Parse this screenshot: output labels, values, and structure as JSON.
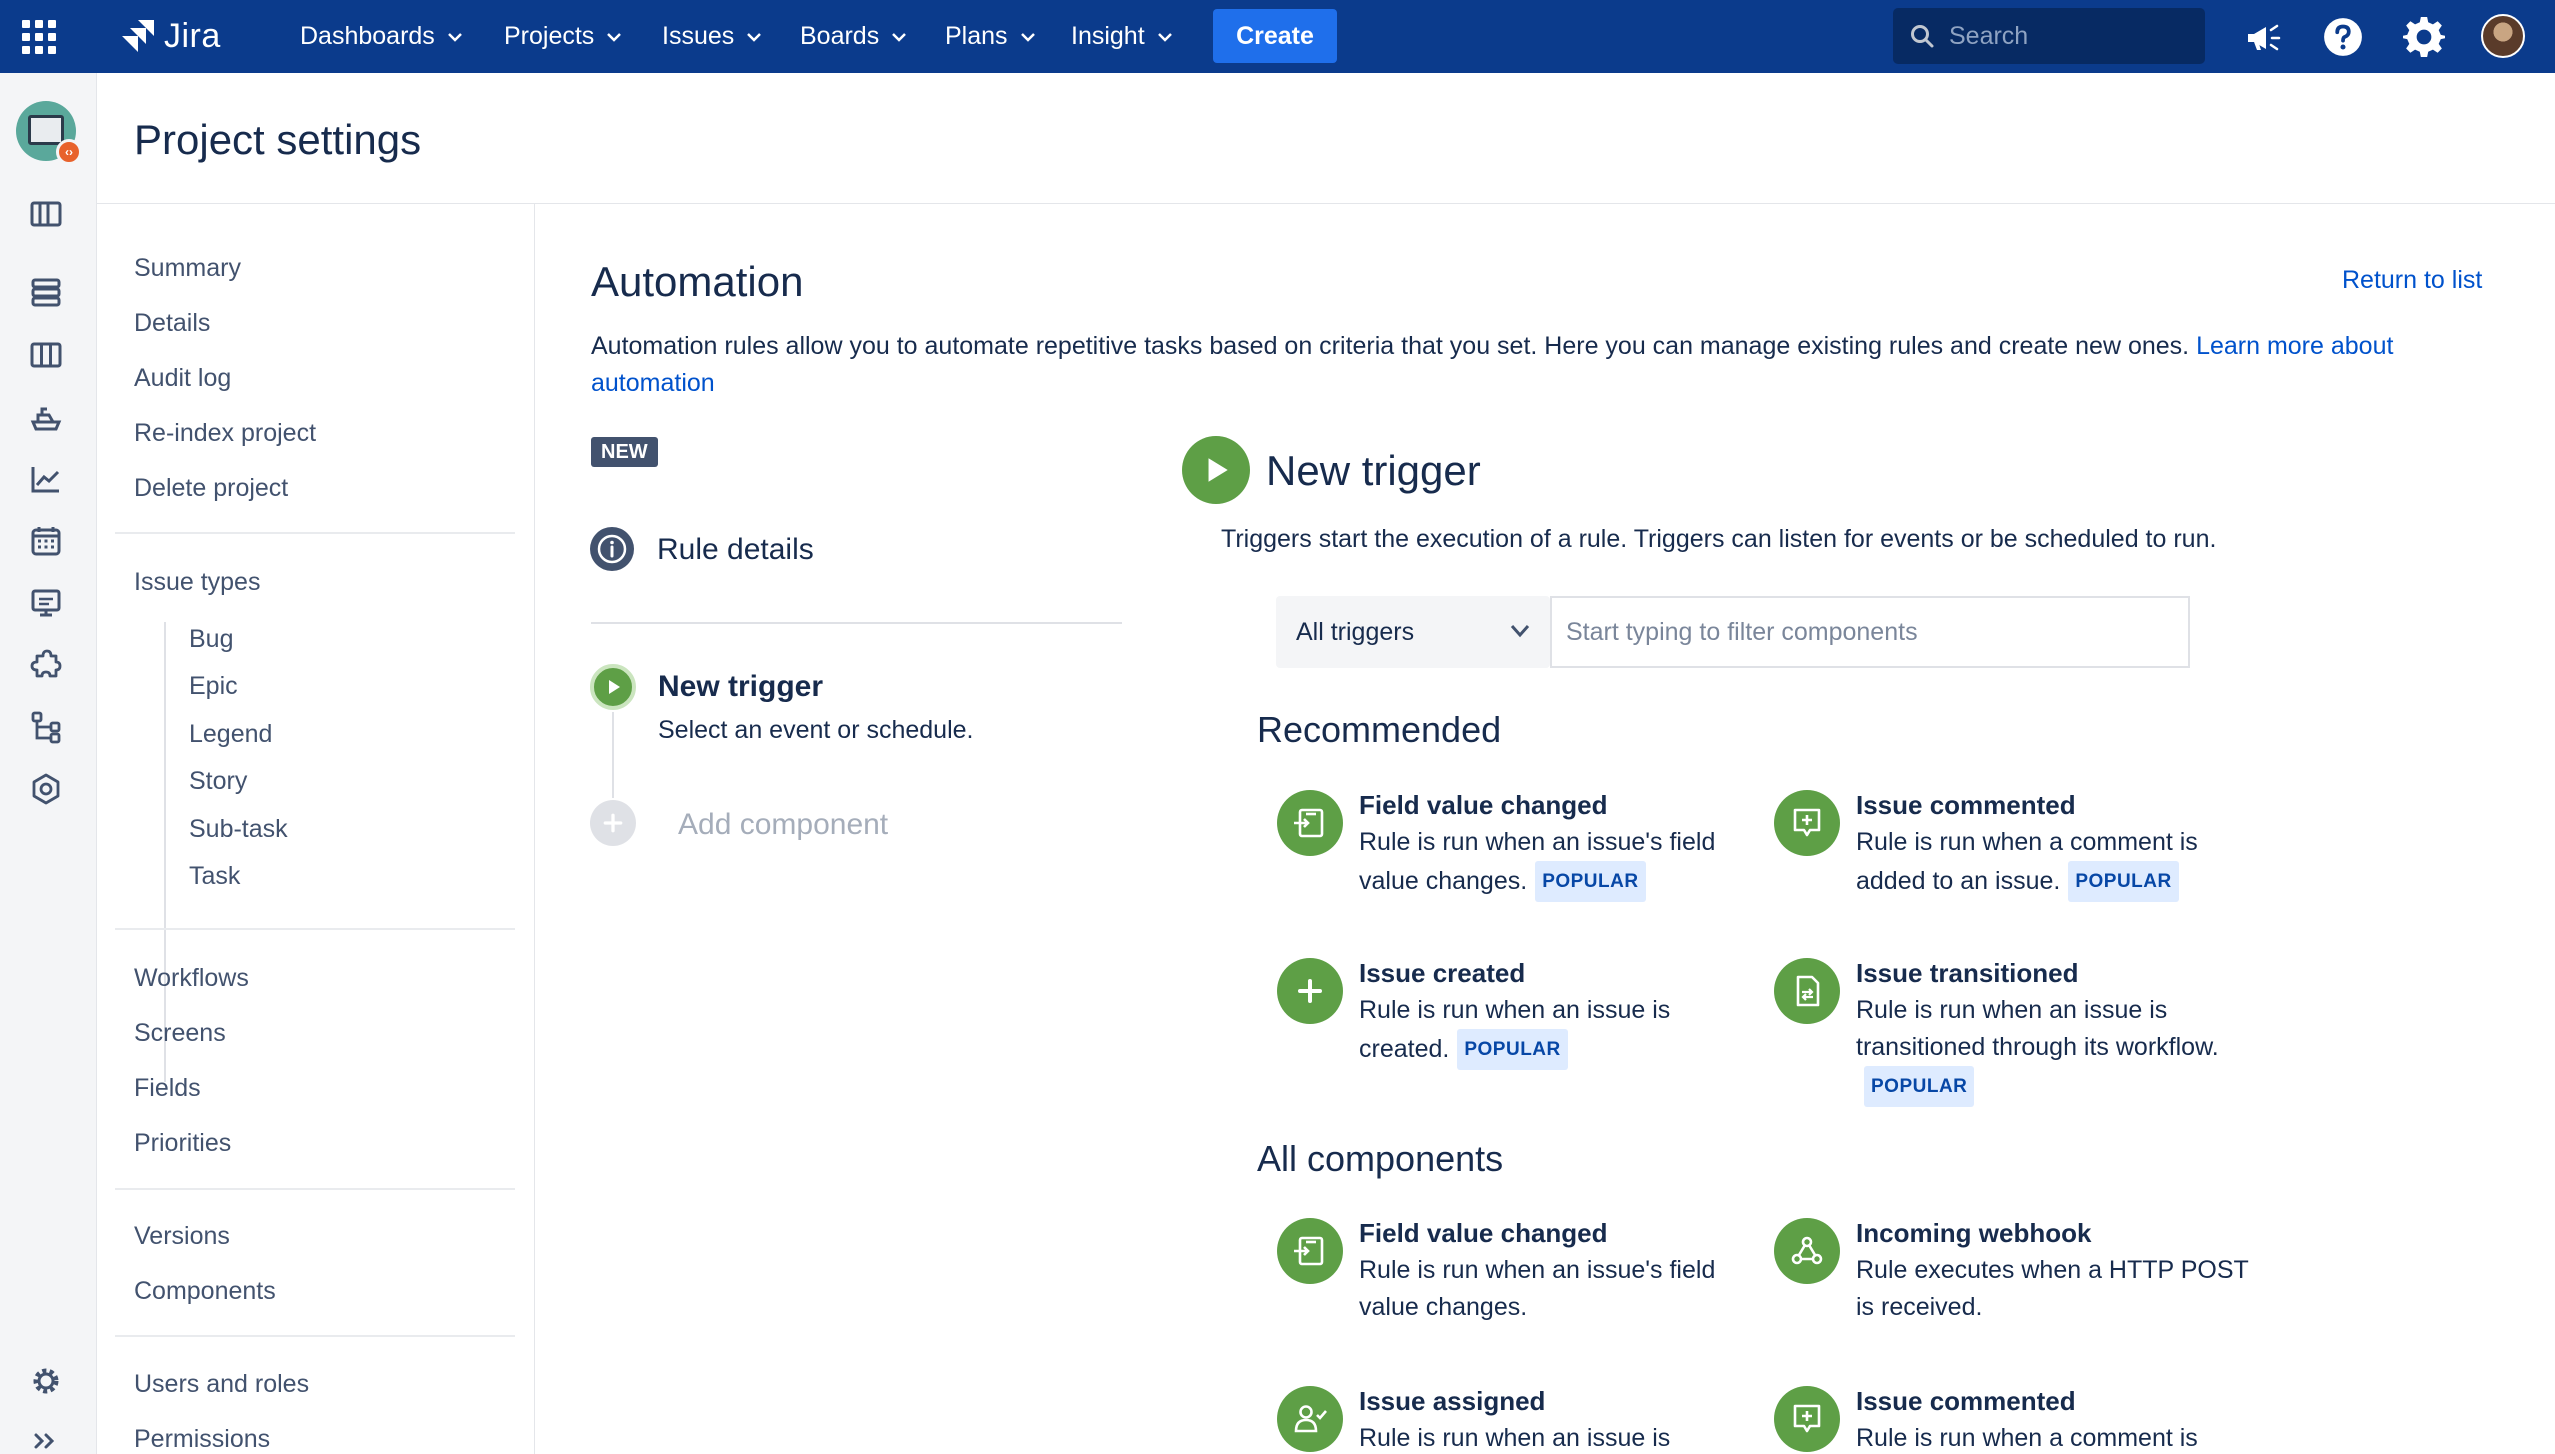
{
  "topnav": {
    "logo_text": "Jira",
    "items": [
      {
        "label": "Dashboards"
      },
      {
        "label": "Projects"
      },
      {
        "label": "Issues"
      },
      {
        "label": "Boards"
      },
      {
        "label": "Plans"
      },
      {
        "label": "Insight"
      }
    ],
    "create_label": "Create",
    "search_placeholder": "Search",
    "icons": [
      "apps-grid-icon",
      "megaphone-icon",
      "help-icon",
      "gear-icon",
      "user-avatar"
    ]
  },
  "rail": {
    "icons": [
      "project-avatar",
      "board-icon",
      "backlog-icon",
      "columns-icon",
      "releases-icon",
      "reports-icon",
      "calendar-icon",
      "monitor-icon",
      "puzzle-icon",
      "hierarchy-icon",
      "component-icon",
      "settings-gear-icon",
      "expand-icon"
    ]
  },
  "page": {
    "title": "Project settings"
  },
  "settings_nav": {
    "group1": [
      "Summary",
      "Details",
      "Audit log",
      "Re-index project",
      "Delete project"
    ],
    "issue_types_label": "Issue types",
    "issue_types": [
      "Bug",
      "Epic",
      "Legend",
      "Story",
      "Sub-task",
      "Task"
    ],
    "group3": [
      "Workflows",
      "Screens",
      "Fields",
      "Priorities"
    ],
    "group4": [
      "Versions",
      "Components"
    ],
    "group5": [
      "Users and roles",
      "Permissions"
    ]
  },
  "automation": {
    "title": "Automation",
    "return_link": "Return to list",
    "description": "Automation rules allow you to automate repetitive tasks based on criteria that you set. Here you can manage existing rules and create new ones.",
    "learn_more_link": "Learn more about automation",
    "new_lozenge": "NEW",
    "rule_details": "Rule details",
    "steps": {
      "trigger_title": "New trigger",
      "trigger_sub": "Select an event or schedule.",
      "add_component": "Add component"
    },
    "new_trigger": {
      "title": "New trigger",
      "description": "Triggers start the execution of a rule. Triggers can listen for events or be scheduled to run.",
      "select_value": "All triggers",
      "filter_placeholder": "Start typing to filter components"
    },
    "popular_label": "POPULAR",
    "recommended_title": "Recommended",
    "recommended": [
      {
        "title": "Field value changed",
        "desc": "Rule is run when an issue's field value changes.",
        "icon": "field-change-icon"
      },
      {
        "title": "Issue commented",
        "desc": "Rule is run when a comment is added to an issue.",
        "icon": "comment-icon"
      },
      {
        "title": "Issue created",
        "desc": "Rule is run when an issue is created.",
        "icon": "plus-icon"
      },
      {
        "title": "Issue transitioned",
        "desc": "Rule is run when an issue is transitioned through its workflow.",
        "icon": "transition-icon"
      }
    ],
    "all_components_title": "All components",
    "all_components": [
      {
        "title": "Field value changed",
        "desc": "Rule is run when an issue's field value changes.",
        "icon": "field-change-icon"
      },
      {
        "title": "Incoming webhook",
        "desc": "Rule executes when a HTTP POST is received.",
        "icon": "webhook-icon"
      },
      {
        "title": "Issue assigned",
        "desc": "Rule is run when an issue is",
        "icon": "assign-icon"
      },
      {
        "title": "Issue commented",
        "desc": "Rule is run when a comment is",
        "icon": "comment-icon"
      }
    ]
  }
}
